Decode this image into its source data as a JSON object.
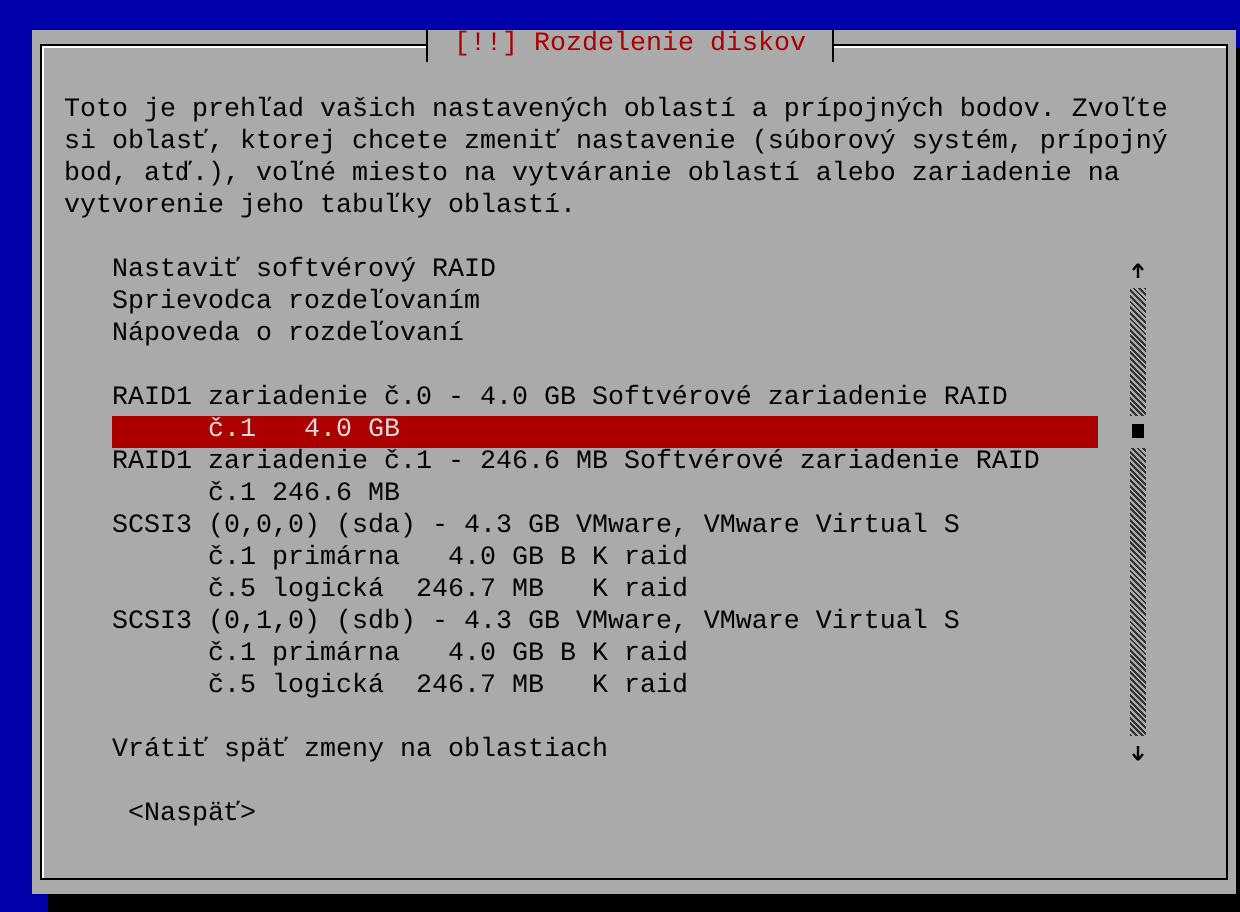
{
  "dialog": {
    "title": "[!!] Rozdelenie diskov",
    "intro": "Toto je prehľad vašich nastavených oblastí a prípojných bodov. Zvoľte\nsi oblasť, ktorej chcete zmeniť nastavenie (súborový systém, prípojný\nbod, atď.), voľné miesto na vytváranie oblastí alebo zariadenie na\nvytvorenie jeho tabuľky oblastí.",
    "menu": {
      "sections": [
        {
          "items": [
            {
              "label": "Nastaviť softvérový RAID",
              "selected": false
            },
            {
              "label": "Sprievodca rozdeľovaním",
              "selected": false
            },
            {
              "label": "Nápoveda o rozdeľovaní",
              "selected": false
            }
          ]
        },
        {
          "items": [
            {
              "label": "RAID1 zariadenie č.0 - 4.0 GB Softvérové zariadenie RAID",
              "selected": false,
              "children": [
                {
                  "label": "č.1   4.0 GB",
                  "selected": true
                }
              ]
            },
            {
              "label": "RAID1 zariadenie č.1 - 246.6 MB Softvérové zariadenie RAID",
              "selected": false,
              "children": [
                {
                  "label": "č.1 246.6 MB",
                  "selected": false
                }
              ]
            },
            {
              "label": "SCSI3 (0,0,0) (sda) - 4.3 GB VMware, VMware Virtual S",
              "selected": false,
              "children": [
                {
                  "label": "č.1 primárna   4.0 GB B K raid",
                  "selected": false
                },
                {
                  "label": "č.5 logická  246.7 MB   K raid",
                  "selected": false
                }
              ]
            },
            {
              "label": "SCSI3 (0,1,0) (sdb) - 4.3 GB VMware, VMware Virtual S",
              "selected": false,
              "children": [
                {
                  "label": "č.1 primárna   4.0 GB B K raid",
                  "selected": false
                },
                {
                  "label": "č.5 logická  246.7 MB   K raid",
                  "selected": false
                }
              ]
            }
          ]
        },
        {
          "items": [
            {
              "label": "Vrátiť späť zmeny na oblastiach",
              "selected": false
            }
          ]
        }
      ]
    },
    "buttons": [
      {
        "label": "<Naspäť>"
      }
    ]
  }
}
